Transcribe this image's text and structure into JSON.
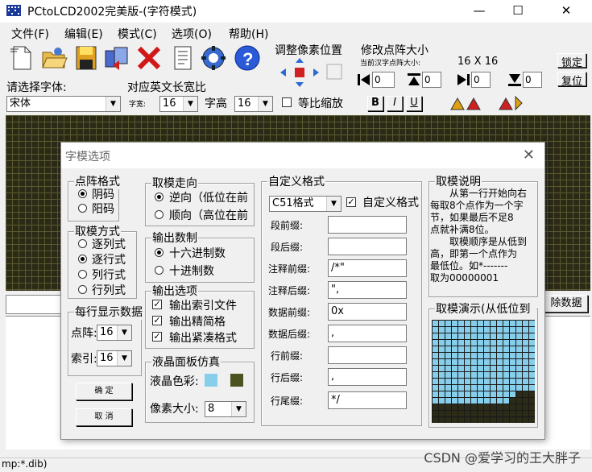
{
  "window": {
    "title": "PCtoLCD2002完美版-(字符模式)",
    "controls": {
      "minimize": "—",
      "maximize": "☐",
      "close": "✕"
    }
  },
  "menu": [
    "文件(F)",
    "编辑(E)",
    "模式(C)",
    "选项(O)",
    "帮助(H)"
  ],
  "toolbar": {
    "icons": [
      "new-file-icon",
      "open-folder-icon",
      "save-icon",
      "export-icon",
      "delete-icon",
      "notes-icon",
      "settings-gear-icon",
      "help-icon"
    ],
    "font_label": "请选择字体:",
    "font_value": "宋体",
    "english_width_label": "对应英文长宽比",
    "width_label": "字宽:",
    "width_value": "16",
    "height_label": "字高",
    "height_value": "16",
    "ratio_label": "等比缩放",
    "style_buttons": [
      "B",
      "I",
      "U"
    ]
  },
  "pixel_position": {
    "title": "调整像素位置"
  },
  "matrix_size": {
    "title": "修改点阵大小",
    "current_label": "当前汉字点阵大小:",
    "current_value": "16 X 16",
    "lock_button": "锁定",
    "reset_button": "复位",
    "spin_values": [
      "0",
      "0",
      "0",
      "0"
    ]
  },
  "side_button": "除数据",
  "status": "mp:*.dib)",
  "watermark": "CSDN @爱学习的王大胖子",
  "dialog": {
    "title": "字模选项",
    "dot_format": {
      "title": "点阵格式",
      "options": [
        "阴码",
        "阳码"
      ],
      "selected": 0
    },
    "take_mode": {
      "title": "取模方式",
      "options": [
        "逐列式",
        "逐行式",
        "列行式",
        "行列式"
      ],
      "selected": 1
    },
    "per_line": {
      "title": "每行显示数据",
      "dot_label": "点阵:",
      "dot_value": "16",
      "index_label": "索引:",
      "index_value": "16"
    },
    "ok_button": "确 定",
    "cancel_button": "取 消",
    "direction": {
      "title": "取模走向",
      "options": [
        "逆向（低位在前",
        "顺向（高位在前"
      ],
      "selected": 0
    },
    "output_base": {
      "title": "输出数制",
      "options": [
        "十六进制数",
        "十进制数"
      ],
      "selected": 0
    },
    "output_options": {
      "title": "输出选项",
      "options": [
        "输出索引文件",
        "输出精简格",
        "输出紧凑格式"
      ]
    },
    "lcd_sim": {
      "title": "液晶面板仿真",
      "color_label": "液晶色彩:",
      "pixel_label": "像素大小:",
      "pixel_value": "8",
      "color_on": "#87ceeb",
      "color_off": "#4b5320"
    },
    "custom_format": {
      "title": "自定义格式",
      "format_value": "C51格式",
      "custom_label": "自定义格式",
      "fields": [
        {
          "label": "段前缀:",
          "value": ""
        },
        {
          "label": "段后缀:",
          "value": ""
        },
        {
          "label": "注释前缀:",
          "value": "/*\""
        },
        {
          "label": "注释后缀:",
          "value": "\","
        },
        {
          "label": "数据前缀:",
          "value": "0x"
        },
        {
          "label": "数据后缀:",
          "value": ","
        },
        {
          "label": "行前缀:",
          "value": ""
        },
        {
          "label": "行后缀:",
          "value": ","
        },
        {
          "label": "行尾缀:",
          "value": "*/"
        }
      ]
    },
    "explain": {
      "title": "取模说明",
      "lines": [
        "从第一行开始向右",
        "每取8个点作为一个字",
        "节，如果最后不足8",
        "点就补满8位。",
        "取模顺序是从低到",
        "高，即第一个点作为",
        "最低位。如*-------",
        "取为00000001"
      ]
    },
    "demo": {
      "title": "取模演示(从低位到"
    }
  }
}
